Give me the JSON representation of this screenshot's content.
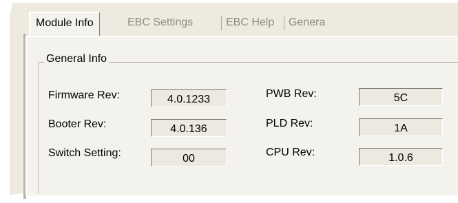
{
  "tabs": [
    {
      "label": "Module Info",
      "active": true
    },
    {
      "label": "EBC Settings",
      "active": false
    },
    {
      "label": "EBC Help",
      "active": false
    },
    {
      "label": "Genera",
      "active": false
    }
  ],
  "general_info": {
    "title": "General Info",
    "firmware_rev": {
      "label": "Firmware Rev:",
      "value": "4.0.1233"
    },
    "booter_rev": {
      "label": "Booter Rev:",
      "value": "4.0.136"
    },
    "switch_setting": {
      "label": "Switch Setting:",
      "value": "00"
    },
    "pwb_rev": {
      "label": "PWB Rev:",
      "value": "5C"
    },
    "pld_rev": {
      "label": "PLD Rev:",
      "value": "1A"
    },
    "cpu_rev": {
      "label": "CPU Rev:",
      "value": "1.0.6"
    }
  }
}
